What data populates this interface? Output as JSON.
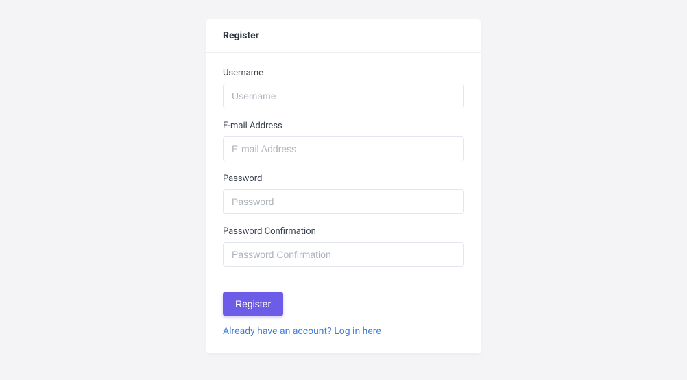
{
  "card": {
    "title": "Register"
  },
  "form": {
    "username": {
      "label": "Username",
      "placeholder": "Username",
      "value": ""
    },
    "email": {
      "label": "E-mail Address",
      "placeholder": "E-mail Address",
      "value": ""
    },
    "password": {
      "label": "Password",
      "placeholder": "Password",
      "value": ""
    },
    "password_confirmation": {
      "label": "Password Confirmation",
      "placeholder": "Password Confirmation",
      "value": ""
    },
    "submit_label": "Register",
    "login_link_text": "Already have an account? Log in here"
  }
}
